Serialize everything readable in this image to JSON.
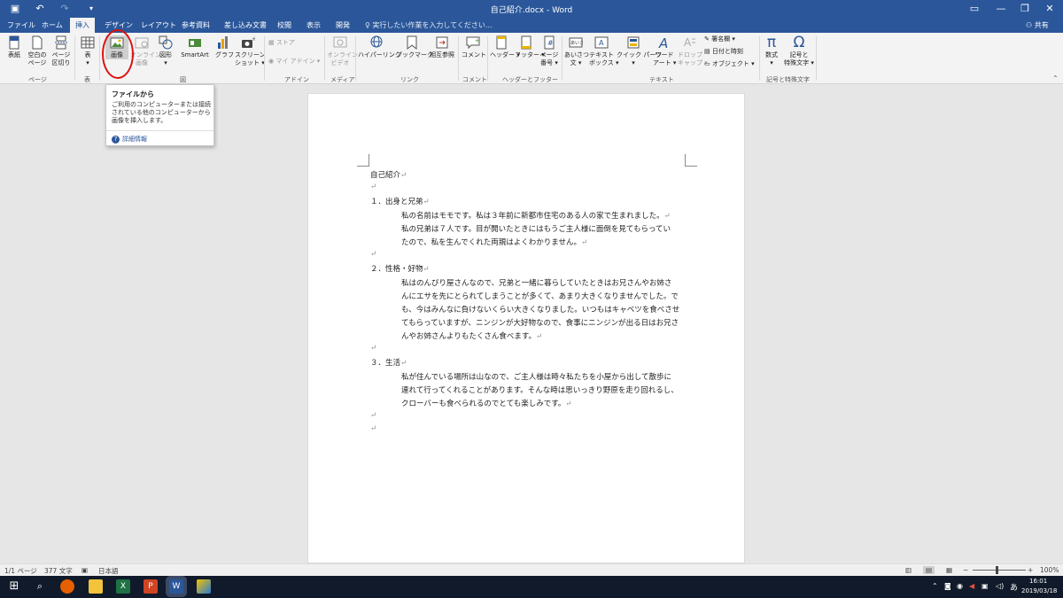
{
  "window": {
    "doc_title": "自己紹介.docx - Word"
  },
  "tabs": [
    {
      "label": "ファイル"
    },
    {
      "label": "ホーム"
    },
    {
      "label": "挿入"
    },
    {
      "label": "デザイン"
    },
    {
      "label": "レイアウト"
    },
    {
      "label": "参考資料"
    },
    {
      "label": "差し込み文書"
    },
    {
      "label": "校閲"
    },
    {
      "label": "表示"
    },
    {
      "label": "開発"
    }
  ],
  "tell_me": "実行したい作業を入力してください...",
  "share": "共有",
  "ribbon": {
    "buttons": {
      "cover": "表紙",
      "blank1": "空白の",
      "blank2": "ページ",
      "pagebreak1": "ページ",
      "pagebreak2": "区切り",
      "table": "表",
      "picture": "画像",
      "online1": "オンライン",
      "online2": "画像",
      "shapes": "図形",
      "smartart": "SmartArt",
      "chart": "グラフ",
      "screenshot1": "スクリーン",
      "screenshot2": "ショット",
      "store": "ストア",
      "myaddins": "マイ アドイン",
      "video1": "オンライン",
      "video2": "ビデオ",
      "hyperlink": "ハイパーリンク",
      "bookmark": "ブックマーク",
      "crossref": "相互参照",
      "comment": "コメント",
      "header": "ヘッダー",
      "footer": "フッター",
      "pagenum1": "ページ",
      "pagenum2": "番号",
      "greeting1": "あいさつ",
      "greeting2": "文",
      "textbox1": "テキスト",
      "textbox2": "ボックス",
      "quickparts": "クイック パーツ",
      "wordart1": "ワード",
      "wordart2": "アート",
      "dropcap1": "ドロップ",
      "dropcap2": "キャップ",
      "signature": "署名欄",
      "datetime": "日付と時刻",
      "object": "オブジェクト",
      "equation": "数式",
      "symbol1": "記号と",
      "symbol2": "特殊文字"
    },
    "groups": {
      "pages": "ページ",
      "tables": "表",
      "illustrations": "図",
      "addins": "アドイン",
      "media": "メディア",
      "links": "リンク",
      "comments": "コメント",
      "headerfooter": "ヘッダーとフッター",
      "text": "テキスト",
      "symbols": "記号と特殊文字"
    }
  },
  "tooltip": {
    "title": "ファイルから",
    "body": "ご利用のコンピューターまたは接続されている他のコンピューターから画像を挿入します。",
    "link": "詳細情報"
  },
  "document": {
    "title": "自己紹介",
    "h1": "１．出身と兄弟",
    "p1_l1": "私の名前はモモです。私は３年前に新都市住宅のある人の家で生まれました。",
    "p1_l2": "私の兄弟は７人です。目が開いたときにはもうご主人様に面倒を見てもらってい",
    "p1_l3": "たので、私を生んでくれた両親はよくわかりません。",
    "h2": "２．性格・好物",
    "p2_l1": "私はのんびり屋さんなので、兄弟と一緒に暮らしていたときはお兄さんやお姉さ",
    "p2_l2": "んにエサを先にとられてしまうことが多くて、あまり大きくなりませんでした。で",
    "p2_l3": "も、今はみんなに負けないくらい大きくなりました。いつもはキャベツを食べさせ",
    "p2_l4": "てもらっていますが、ニンジンが大好物なので、食事にニンジンが出る日はお兄さ",
    "p2_l5": "んやお姉さんよりもたくさん食べます。",
    "h3": "３．生活",
    "p3_l1": "私が住んでいる場所は山なので、ご主人様は時々私たちを小屋から出して散歩に",
    "p3_l2": "連れて行ってくれることがあります。そんな時は思いっきり野原を走り回れるし、",
    "p3_l3": "クローバーも食べられるのでとても楽しみです。",
    "para_mark": "↵"
  },
  "status": {
    "page": "1/1 ページ",
    "words": "377 文字",
    "lang": "日本語",
    "zoom": "100%"
  },
  "tray": {
    "time": "16:01",
    "date": "2019/03/18",
    "ime": "あ"
  },
  "colors": {
    "accent": "#2b579a",
    "highlight": "#dd1111"
  }
}
